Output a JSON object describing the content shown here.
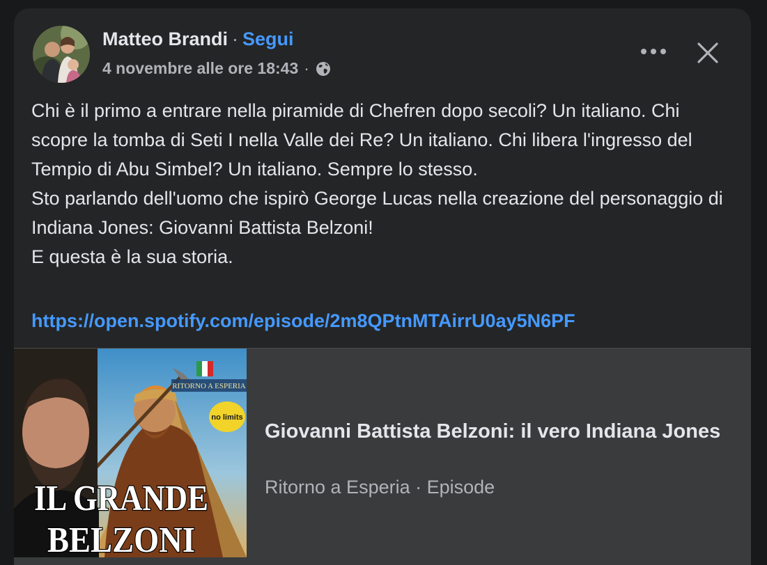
{
  "post": {
    "author": "Matteo Brandi",
    "separator": "·",
    "follow_label": "Segui",
    "timestamp": "4 novembre alle ore 18:43",
    "privacy_icon": "globe-icon",
    "more_icon": "more-icon",
    "close_icon": "close-icon",
    "paragraphs": [
      "Chi è il primo a entrare nella piramide di Chefren dopo secoli? Un italiano. Chi scopre la tomba di Seti I nella Valle dei Re? Un italiano. Chi libera l'ingresso del Tempio di Abu Simbel? Un italiano. Sempre lo stesso.",
      "Sto parlando dell'uomo che ispirò George Lucas nella creazione del personaggio di Indiana Jones: Giovanni Battista Belzoni!",
      "E questa è la sua storia."
    ],
    "link": "https://open.spotify.com/episode/2m8QPtnMTAirrU0ay5N6PF"
  },
  "preview": {
    "title": "Giovanni Battista Belzoni: il vero Indiana Jones",
    "subtitle": "Ritorno a Esperia · Episode",
    "thumbnail": {
      "headline_line1": "IL GRANDE",
      "headline_line2": "BELZONI",
      "logo_text": "RITORNO A ESPERIA",
      "badge_text": "no limits"
    }
  },
  "colors": {
    "background": "#18191a",
    "card": "#242526",
    "text_primary": "#e4e6eb",
    "text_secondary": "#b0b3b8",
    "link": "#4599ff",
    "preview_bg": "#3a3b3c"
  }
}
